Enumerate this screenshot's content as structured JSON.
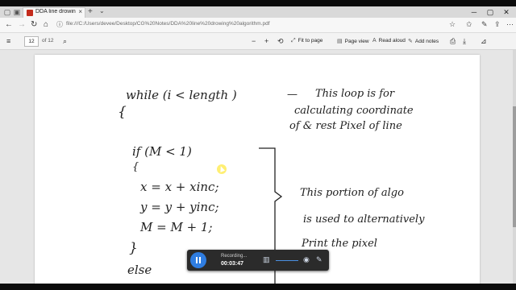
{
  "browser": {
    "tab_title": "DDA line drowing algor",
    "new_tab_symbol": "+",
    "url": "file:///C:/Users/devee/Desktop/CG%20Notes/DDA%20line%20drowing%20algorithm.pdf"
  },
  "pdf_toolbar": {
    "current_page": "12",
    "page_count": "of 12",
    "fit_to_page": "Fit to page",
    "page_view": "Page view",
    "read_aloud": "Read aloud",
    "add_notes": "Add notes"
  },
  "page_content": {
    "line_while": "while (i < length )",
    "brace_open": "{",
    "dash": "—",
    "note1_line1": "This loop is for",
    "note1_line2": "calculating coordinate",
    "note1_line3": "of & rest Pixel of line",
    "line_if": "if  (M < 1)",
    "brace_small": "{",
    "line_x": "x = x + xinc;",
    "line_y": "y = y + yinc;",
    "line_m": "M = M + 1;",
    "brace_close": "}",
    "line_else": "else",
    "note2_line1": "This portion of algo",
    "note2_line2": "is used to alternatively",
    "note2_line3": "Print the pixel"
  },
  "recorder": {
    "status": "Recording...",
    "elapsed": "00:03:47"
  },
  "icons": [
    "back-arrow-icon",
    "forward-arrow-icon",
    "refresh-icon",
    "home-icon",
    "favorites-star-icon",
    "hub-icon",
    "share-icon",
    "more-icon",
    "search-icon",
    "zoom-out-icon",
    "zoom-in-icon",
    "rotate-icon",
    "fit-icon",
    "page-view-icon",
    "read-aloud-icon",
    "add-notes-icon",
    "print-icon",
    "save-icon",
    "pin-icon",
    "pause-icon",
    "pen-icon"
  ],
  "colors": {
    "accent": "#2f7de1",
    "pdf_red": "#c42b1c",
    "ink": "#222222"
  }
}
